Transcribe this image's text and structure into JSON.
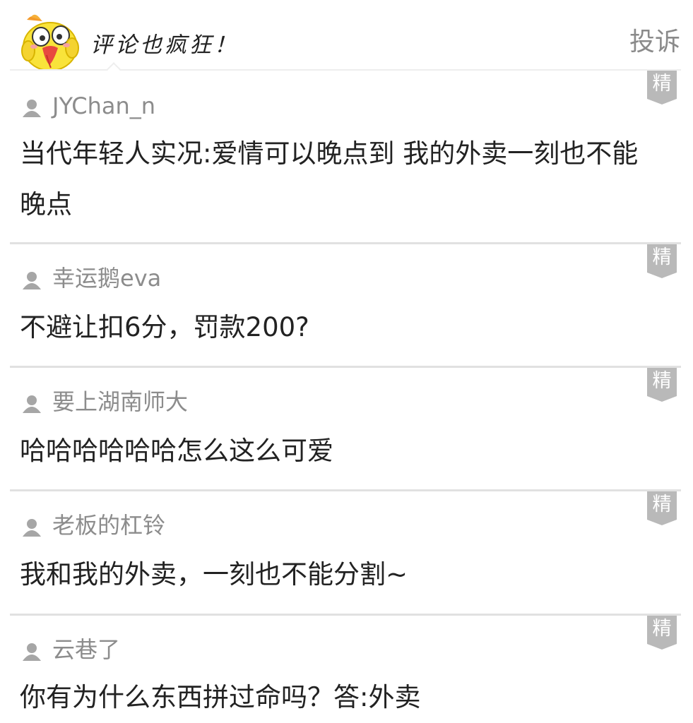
{
  "header": {
    "title": "评论也疯狂！",
    "report_label": "投诉",
    "mascot_icon": "yellow-chick-mascot-icon"
  },
  "badge_label": "精",
  "comments": [
    {
      "user": "JYChan_n",
      "text": "当代年轻人实况:爱情可以晚点到 我的外卖一刻也不能晚点"
    },
    {
      "user": "幸运鹅eva",
      "text": "不避让扣6分，罚款200?"
    },
    {
      "user": "要上湖南师大",
      "text": "哈哈哈哈哈哈怎么这么可爱"
    },
    {
      "user": "老板的杠铃",
      "text": "我和我的外卖，一刻也不能分割~"
    },
    {
      "user": "云巷了",
      "text": "你有为什么东西拼过命吗？答:外卖"
    }
  ],
  "colors": {
    "badge": "#b9b9b9",
    "username": "#8c8c8c",
    "report": "#8a8a8a",
    "divider": "#e1e1e1"
  }
}
